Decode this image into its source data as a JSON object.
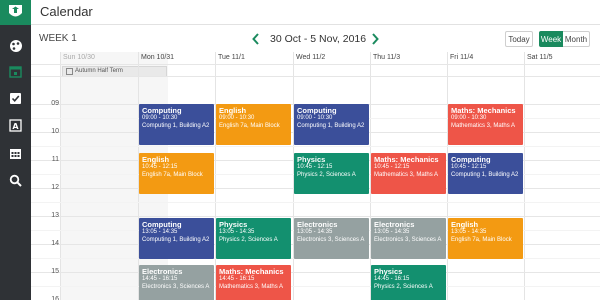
{
  "app": {
    "title": "Calendar"
  },
  "toolbar": {
    "week_label": "WEEK 1",
    "range": "30 Oct - 5 Nov, 2016",
    "today": "Today",
    "week": "Week",
    "month": "Month"
  },
  "colors": {
    "blue": "#3b4f9a",
    "orange": "#f39a12",
    "teal": "#13906f",
    "red": "#ee5548",
    "gray": "#95a1a1",
    "accent": "#1a8a5e"
  },
  "sidebar_icons": [
    "logo-icon",
    "palette-icon",
    "calendar-day-icon",
    "checkbox-icon",
    "id-card-icon",
    "calendar-grid-icon",
    "search-icon"
  ],
  "days": [
    {
      "label": "Sun 10/30",
      "dim": true
    },
    {
      "label": "Mon 10/31"
    },
    {
      "label": "Tue 11/1"
    },
    {
      "label": "Wed 11/2"
    },
    {
      "label": "Thu 11/3"
    },
    {
      "label": "Fri 11/4"
    },
    {
      "label": "Sat 11/5"
    }
  ],
  "all_day": {
    "label": "Autumn Half Term",
    "day": 0
  },
  "hours": [
    "09",
    "10",
    "11",
    "12",
    "13",
    "14",
    "15",
    "16"
  ],
  "events": [
    {
      "day": 1,
      "start": 9.0,
      "end": 10.5,
      "title": "Computing",
      "time": "09:00 - 10:30",
      "loc": "Computing 1, Building A2",
      "color": "blue"
    },
    {
      "day": 2,
      "start": 9.0,
      "end": 10.5,
      "title": "English",
      "time": "09:00 - 10:30",
      "loc": "English 7a, Main Block",
      "color": "orange"
    },
    {
      "day": 3,
      "start": 9.0,
      "end": 10.5,
      "title": "Computing",
      "time": "09:00 - 10:30",
      "loc": "Computing 1, Building A2",
      "color": "blue"
    },
    {
      "day": 5,
      "start": 9.0,
      "end": 10.5,
      "title": "Maths: Mechanics",
      "time": "09:00 - 10:30",
      "loc": "Mathematics 3, Maths A",
      "color": "red"
    },
    {
      "day": 1,
      "start": 10.75,
      "end": 12.25,
      "title": "English",
      "time": "10:45 - 12:15",
      "loc": "English 7a, Main Block",
      "color": "orange"
    },
    {
      "day": 3,
      "start": 10.75,
      "end": 12.25,
      "title": "Physics",
      "time": "10:45 - 12:15",
      "loc": "Physics 2, Sciences A",
      "color": "teal"
    },
    {
      "day": 4,
      "start": 10.75,
      "end": 12.25,
      "title": "Maths: Mechanics",
      "time": "10:45 - 12:15",
      "loc": "Mathematics 3, Maths A",
      "color": "red"
    },
    {
      "day": 5,
      "start": 10.75,
      "end": 12.25,
      "title": "Computing",
      "time": "10:45 - 12:15",
      "loc": "Computing 1, Building A2",
      "color": "blue"
    },
    {
      "day": 1,
      "start": 13.083,
      "end": 14.583,
      "title": "Computing",
      "time": "13:05 - 14:35",
      "loc": "Computing 1, Building A2",
      "color": "blue"
    },
    {
      "day": 2,
      "start": 13.083,
      "end": 14.583,
      "title": "Physics",
      "time": "13:05 - 14:35",
      "loc": "Physics 2, Sciences A",
      "color": "teal"
    },
    {
      "day": 3,
      "start": 13.083,
      "end": 14.583,
      "title": "Electronics",
      "time": "13:05 - 14:35",
      "loc": "Electronics 3, Sciences A",
      "color": "gray"
    },
    {
      "day": 4,
      "start": 13.083,
      "end": 14.583,
      "title": "Electronics",
      "time": "13:05 - 14:35",
      "loc": "Electronics 3, Sciences A",
      "color": "gray"
    },
    {
      "day": 5,
      "start": 13.083,
      "end": 14.583,
      "title": "English",
      "time": "13:05 - 14:35",
      "loc": "English 7a, Main Block",
      "color": "orange"
    },
    {
      "day": 1,
      "start": 14.75,
      "end": 16.25,
      "title": "Electronics",
      "time": "14:45 - 16:15",
      "loc": "Electronics 3, Sciences A",
      "color": "gray"
    },
    {
      "day": 2,
      "start": 14.75,
      "end": 16.25,
      "title": "Maths: Mechanics",
      "time": "14:45 - 16:15",
      "loc": "Mathematics 3, Maths A",
      "color": "red"
    },
    {
      "day": 4,
      "start": 14.75,
      "end": 16.25,
      "title": "Physics",
      "time": "14:45 - 16:15",
      "loc": "Physics 2, Sciences A",
      "color": "teal"
    }
  ]
}
